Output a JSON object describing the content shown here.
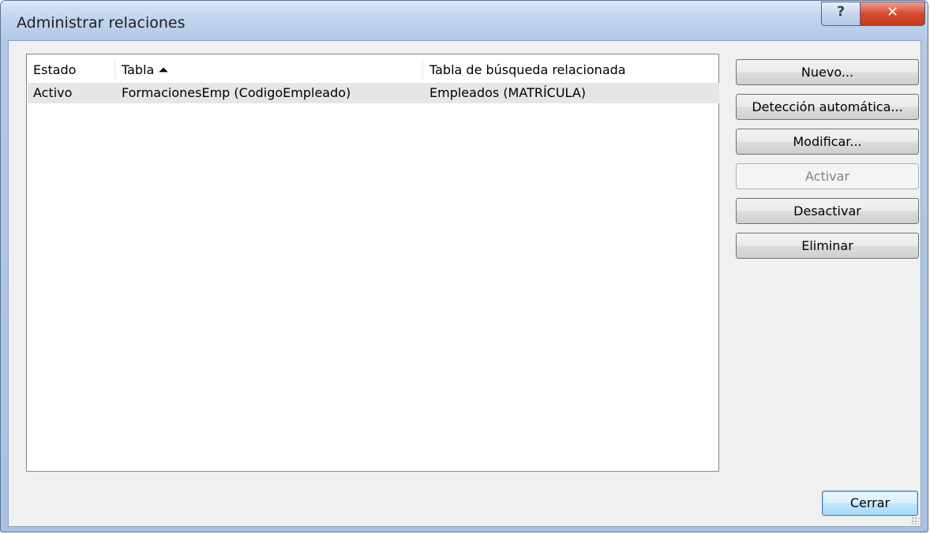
{
  "window": {
    "title": "Administrar relaciones",
    "help_glyph": "?",
    "close_glyph": "✕"
  },
  "table": {
    "columns": [
      "Estado",
      "Tabla ⏶",
      "Tabla de búsqueda relacionada"
    ],
    "rows": [
      {
        "estado": "Activo",
        "tabla": "FormacionesEmp (CodigoEmpleado)",
        "busqueda": "Empleados (MATRÍCULA)"
      }
    ]
  },
  "buttons": {
    "nuevo": "Nuevo...",
    "deteccion": "Detección automática...",
    "modificar": "Modificar...",
    "activar": "Activar",
    "desactivar": "Desactivar",
    "eliminar": "Eliminar",
    "cerrar": "Cerrar"
  },
  "icons": {
    "sort": "sort-ascending-icon",
    "help": "help-icon",
    "close": "close-icon"
  },
  "colors": {
    "title_bar": "#b9cee9",
    "close_button": "#d44a2f",
    "default_button_border": "#3c7fb1",
    "selected_row": "#e6e6e6"
  }
}
